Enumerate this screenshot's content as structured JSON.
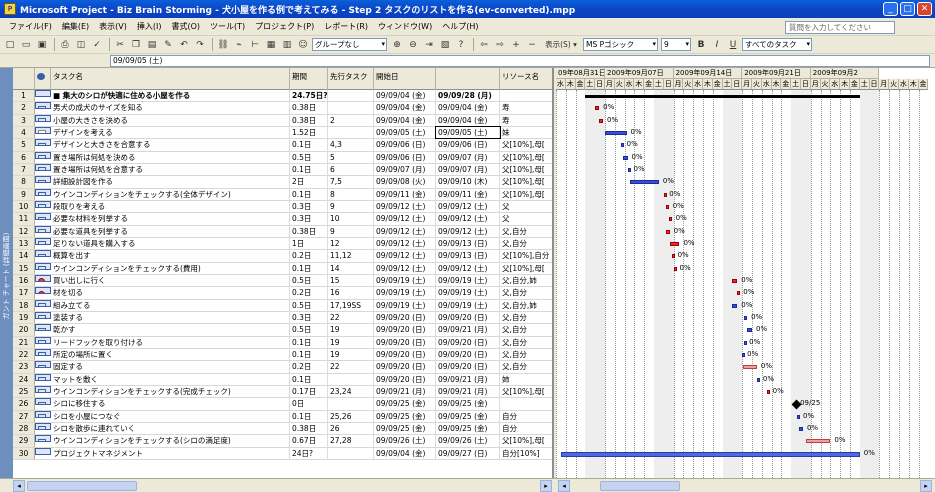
{
  "window": {
    "title": "Microsoft Project - Biz Brain Storming - 犬小屋を作る例で考えてみる - Step 2 タスクのリストを作る(ev-converted).mpp"
  },
  "menu": [
    "ファイル(F)",
    "編集(E)",
    "表示(V)",
    "挿入(I)",
    "書式(O)",
    "ツール(T)",
    "プロジェクト(P)",
    "レポート(R)",
    "ウィンドウ(W)",
    "ヘルプ(H)"
  ],
  "help_placeholder": "質問を入力してください",
  "toolbar": {
    "group": "グループなし",
    "view_menu": "表示(S) ▾",
    "font": "MS Pゴシック",
    "size": "9",
    "bold": "B",
    "italic": "I",
    "underline": "U",
    "filter": "すべてのタスク"
  },
  "entry_value": "09/09/05 (土)",
  "view_bar_label": "ガント チャート (詳細画面)",
  "columns": {
    "name": "タスク名",
    "dur": "期間",
    "pred": "先行タスク",
    "start": "開始日",
    "finish": "終了日",
    "res": "リソース名"
  },
  "rows": [
    {
      "id": "1",
      "name": "■ 集大のシロが快適に住める小屋を作る",
      "dur": "24.75日?",
      "pred": "",
      "start": "09/09/04 (金)",
      "fi": "09/09/28 (月)",
      "res": "",
      "ind": ""
    },
    {
      "id": "2",
      "name": "男犬の成犬のサイズを知る",
      "dur": "0.38日",
      "pred": "",
      "start": "09/09/04 (金)",
      "fi": "09/09/04 (金)",
      "res": "寿",
      "ind": ""
    },
    {
      "id": "3",
      "name": "小屋の大きさを決める",
      "dur": "0.38日",
      "pred": "2",
      "start": "09/09/04 (金)",
      "fi": "09/09/04 (金)",
      "res": "寿",
      "ind": ""
    },
    {
      "id": "4",
      "name": "デザインを考える",
      "dur": "1.52日",
      "pred": "",
      "start": "09/09/05 (土)",
      "fi": "09/09/05 (土)",
      "res": "妹",
      "ind": "n"
    },
    {
      "id": "5",
      "name": "デザインと大きさを合意する",
      "dur": "0.1日",
      "pred": "4,3",
      "start": "09/09/06 (日)",
      "fi": "09/09/06 (日)",
      "res": "父[10%],母[",
      "ind": ""
    },
    {
      "id": "6",
      "name": "置き場所は何処を決める",
      "dur": "0.5日",
      "pred": "5",
      "start": "09/09/06 (日)",
      "fi": "09/09/07 (月)",
      "res": "父[10%],母[",
      "ind": ""
    },
    {
      "id": "7",
      "name": "置き場所は何処を合意する",
      "dur": "0.1日",
      "pred": "6",
      "start": "09/09/07 (月)",
      "fi": "09/09/07 (月)",
      "res": "父[10%],母[",
      "ind": ""
    },
    {
      "id": "8",
      "name": "詳細設計図を作る",
      "dur": "2日",
      "pred": "7,5",
      "start": "09/09/08 (火)",
      "fi": "09/09/10 (木)",
      "res": "父[10%],母[",
      "ind": ""
    },
    {
      "id": "9",
      "name": "ウインコンディションをチェックする(全体デザイン)",
      "dur": "0.1日",
      "pred": "8",
      "start": "09/09/11 (金)",
      "fi": "09/09/11 (金)",
      "res": "父[10%],母[",
      "ind": ""
    },
    {
      "id": "10",
      "name": "段取りを考える",
      "dur": "0.3日",
      "pred": "9",
      "start": "09/09/12 (土)",
      "fi": "09/09/12 (土)",
      "res": "父",
      "ind": ""
    },
    {
      "id": "11",
      "name": "必要な材料を列挙する",
      "dur": "0.3日",
      "pred": "10",
      "start": "09/09/12 (土)",
      "fi": "09/09/12 (土)",
      "res": "父",
      "ind": ""
    },
    {
      "id": "12",
      "name": "必要な道具を列挙する",
      "dur": "0.38日",
      "pred": "9",
      "start": "09/09/12 (土)",
      "fi": "09/09/12 (土)",
      "res": "父,自分",
      "ind": ""
    },
    {
      "id": "13",
      "name": "足りない道具を購入する",
      "dur": "1日",
      "pred": "12",
      "start": "09/09/12 (土)",
      "fi": "09/09/13 (日)",
      "res": "父,自分",
      "ind": ""
    },
    {
      "id": "14",
      "name": "概算を出す",
      "dur": "0.2日",
      "pred": "11,12",
      "start": "09/09/12 (土)",
      "fi": "09/09/13 (日)",
      "res": "父[10%],自分",
      "ind": ""
    },
    {
      "id": "15",
      "name": "ウインコンディションをチェックする(費用)",
      "dur": "0.1日",
      "pred": "14",
      "start": "09/09/12 (土)",
      "fi": "09/09/12 (土)",
      "res": "父[10%],母[",
      "ind": ""
    },
    {
      "id": "16",
      "name": "買い出しに行く",
      "dur": "0.5日",
      "pred": "15",
      "start": "09/09/19 (土)",
      "fi": "09/09/19 (土)",
      "res": "父,自分,姉",
      "ind": "w"
    },
    {
      "id": "17",
      "name": "材を切る",
      "dur": "0.2日",
      "pred": "16",
      "start": "09/09/19 (土)",
      "fi": "09/09/19 (土)",
      "res": "父,自分",
      "ind": "w"
    },
    {
      "id": "18",
      "name": "組み立てる",
      "dur": "0.5日",
      "pred": "17,19SS",
      "start": "09/09/19 (土)",
      "fi": "09/09/19 (土)",
      "res": "父,自分,姉",
      "ind": ""
    },
    {
      "id": "19",
      "name": "塗装する",
      "dur": "0.3日",
      "pred": "22",
      "start": "09/09/20 (日)",
      "fi": "09/09/20 (日)",
      "res": "父,自分",
      "ind": ""
    },
    {
      "id": "20",
      "name": "乾かす",
      "dur": "0.5日",
      "pred": "19",
      "start": "09/09/20 (日)",
      "fi": "09/09/21 (月)",
      "res": "父,自分",
      "ind": ""
    },
    {
      "id": "21",
      "name": "リードフックを取り付ける",
      "dur": "0.1日",
      "pred": "19",
      "start": "09/09/20 (日)",
      "fi": "09/09/20 (日)",
      "res": "父,自分",
      "ind": ""
    },
    {
      "id": "22",
      "name": "所定の場所に置く",
      "dur": "0.1日",
      "pred": "19",
      "start": "09/09/20 (日)",
      "fi": "09/09/20 (日)",
      "res": "父,自分",
      "ind": ""
    },
    {
      "id": "23",
      "name": "固定する",
      "dur": "0.2日",
      "pred": "22",
      "start": "09/09/20 (日)",
      "fi": "09/09/20 (日)",
      "res": "父,自分",
      "ind": ""
    },
    {
      "id": "24",
      "name": "マットを敷く",
      "dur": "0.1日",
      "pred": "",
      "start": "09/09/20 (日)",
      "fi": "09/09/21 (月)",
      "res": "姉",
      "ind": ""
    },
    {
      "id": "25",
      "name": "ウインコンディションをチェックする(完成チェック)",
      "dur": "0.17日",
      "pred": "23,24",
      "start": "09/09/21 (月)",
      "fi": "09/09/21 (月)",
      "res": "父[10%],母[",
      "ind": ""
    },
    {
      "id": "26",
      "name": "シロに移住する",
      "dur": "0日",
      "pred": "",
      "start": "09/09/25 (金)",
      "fi": "09/09/25 (金)",
      "res": "",
      "ind": ""
    },
    {
      "id": "27",
      "name": "シロを小屋につなぐ",
      "dur": "0.1日",
      "pred": "25,26",
      "start": "09/09/25 (金)",
      "fi": "09/09/25 (金)",
      "res": "自分",
      "ind": ""
    },
    {
      "id": "28",
      "name": "シロを散歩に連れていく",
      "dur": "0.38日",
      "pred": "26",
      "start": "09/09/25 (金)",
      "fi": "09/09/25 (金)",
      "res": "自分",
      "ind": ""
    },
    {
      "id": "29",
      "name": "ウインコンディションをチェックする(シロの満足度)",
      "dur": "0.67日",
      "pred": "27,28",
      "start": "09/09/26 (土)",
      "fi": "09/09/26 (土)",
      "res": "父[10%],母[",
      "ind": ""
    },
    {
      "id": "30",
      "name": "プロジェクトマネジメント",
      "dur": "24日?",
      "pred": "",
      "start": "09/09/04 (金)",
      "fi": "09/09/27 (日)",
      "res": "自分[10%]",
      "ind": ""
    }
  ],
  "weeks": [
    "09年08月31日",
    "2009年09月07日",
    "2009年09月14日",
    "2009年09月21日",
    "2009年09月2"
  ],
  "days": [
    "水",
    "木",
    "金",
    "土",
    "日",
    "月",
    "火",
    "水",
    "木",
    "金",
    "土",
    "日",
    "月",
    "火",
    "水",
    "木",
    "金",
    "土",
    "日",
    "月",
    "火",
    "水",
    "木",
    "金",
    "土",
    "日",
    "月",
    "火",
    "水",
    "木",
    "金",
    "土",
    "日",
    "月",
    "火",
    "水",
    "木",
    "金"
  ],
  "gantt": [
    {
      "row": 1,
      "type": "sum",
      "s": 3,
      "e": 31
    },
    {
      "row": 2,
      "type": "crit",
      "s": 4.0,
      "e": 4.4,
      "label": "0%"
    },
    {
      "row": 3,
      "type": "crit",
      "s": 4.4,
      "e": 4.8,
      "label": "0%"
    },
    {
      "row": 4,
      "type": "task",
      "s": 5.0,
      "e": 7.2,
      "label": "0%"
    },
    {
      "row": 5,
      "type": "task",
      "s": 6.6,
      "e": 6.8,
      "label": "0%"
    },
    {
      "row": 6,
      "type": "task",
      "s": 6.8,
      "e": 7.3,
      "label": "0%"
    },
    {
      "row": 7,
      "type": "task",
      "s": 7.3,
      "e": 7.5,
      "label": "0%"
    },
    {
      "row": 8,
      "type": "task",
      "s": 7.5,
      "e": 10.5,
      "label": "0%"
    },
    {
      "row": 9,
      "type": "crit",
      "s": 11.0,
      "e": 11.15,
      "label": "0%"
    },
    {
      "row": 10,
      "type": "crit",
      "s": 11.2,
      "e": 11.5,
      "label": "0%"
    },
    {
      "row": 11,
      "type": "crit",
      "s": 11.5,
      "e": 11.8,
      "label": "0%"
    },
    {
      "row": 12,
      "type": "crit",
      "s": 11.2,
      "e": 11.6,
      "label": "0%"
    },
    {
      "row": 13,
      "type": "crit",
      "s": 11.6,
      "e": 12.6,
      "label": "0%"
    },
    {
      "row": 14,
      "type": "crit",
      "s": 11.8,
      "e": 12.0,
      "label": "0%"
    },
    {
      "row": 15,
      "type": "crit",
      "s": 12.0,
      "e": 12.2,
      "label": "0%"
    },
    {
      "row": 16,
      "type": "crit",
      "s": 18.0,
      "e": 18.5,
      "label": "0%"
    },
    {
      "row": 17,
      "type": "crit",
      "s": 18.5,
      "e": 18.7,
      "label": "0%"
    },
    {
      "row": 18,
      "type": "task",
      "s": 18.0,
      "e": 18.5,
      "label": "0%"
    },
    {
      "row": 19,
      "type": "task",
      "s": 19.2,
      "e": 19.5,
      "label": "0%"
    },
    {
      "row": 20,
      "type": "task",
      "s": 19.5,
      "e": 20.0,
      "label": "0%"
    },
    {
      "row": 21,
      "type": "task",
      "s": 19.2,
      "e": 19.3,
      "label": "0%"
    },
    {
      "row": 22,
      "type": "task",
      "s": 19.0,
      "e": 19.1,
      "label": "0%"
    },
    {
      "row": 23,
      "type": "base",
      "s": 19.1,
      "e": 20.5,
      "label": "0%"
    },
    {
      "row": 24,
      "type": "task",
      "s": 20.5,
      "e": 20.7,
      "label": "0%"
    },
    {
      "row": 25,
      "type": "crit",
      "s": 21.5,
      "e": 21.7,
      "label": "0%"
    },
    {
      "row": 26,
      "type": "ms",
      "s": 24.5,
      "label": "09/25"
    },
    {
      "row": 27,
      "type": "task",
      "s": 24.6,
      "e": 24.8,
      "label": "0%"
    },
    {
      "row": 28,
      "type": "task",
      "s": 24.8,
      "e": 25.2,
      "label": "0%"
    },
    {
      "row": 29,
      "type": "base",
      "s": 25.5,
      "e": 28.0,
      "label": "0%"
    },
    {
      "row": 30,
      "type": "proj",
      "s": 0.5,
      "e": 31.0,
      "label": "0%"
    }
  ]
}
